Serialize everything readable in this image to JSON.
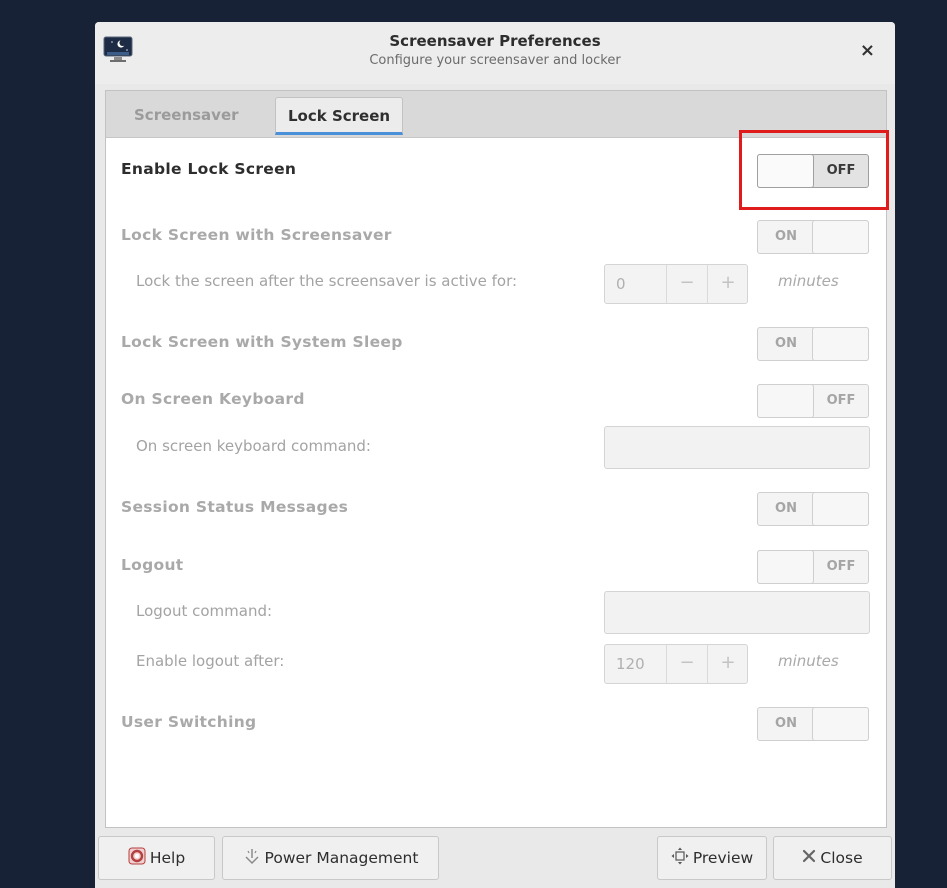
{
  "window": {
    "title": "Screensaver Preferences",
    "subtitle": "Configure your screensaver and locker",
    "close_glyph": "×"
  },
  "tabs": [
    {
      "label": "Screensaver",
      "selected": false
    },
    {
      "label": "Lock Screen",
      "selected": true
    }
  ],
  "settings": {
    "enable_lock_screen": {
      "label": "Enable Lock Screen",
      "state": "OFF"
    },
    "lock_with_screensaver": {
      "label": "Lock Screen with Screensaver",
      "state": "ON"
    },
    "lock_after": {
      "label": "Lock the screen after the screensaver is active for:",
      "value": "0",
      "unit": "minutes"
    },
    "lock_with_sleep": {
      "label": "Lock Screen with System Sleep",
      "state": "ON"
    },
    "on_screen_keyboard": {
      "label": "On Screen Keyboard",
      "state": "OFF"
    },
    "osk_command": {
      "label": "On screen keyboard command:",
      "value": ""
    },
    "session_status": {
      "label": "Session Status Messages",
      "state": "ON"
    },
    "logout": {
      "label": "Logout",
      "state": "OFF"
    },
    "logout_command": {
      "label": "Logout command:",
      "value": ""
    },
    "logout_after": {
      "label": "Enable logout after:",
      "value": "120",
      "unit": "minutes"
    },
    "user_switching": {
      "label": "User Switching",
      "state": "ON"
    }
  },
  "spin_glyphs": {
    "minus": "−",
    "plus": "+"
  },
  "buttons": {
    "help": "Help",
    "power_management": "Power Management",
    "preview": "Preview",
    "close": "Close"
  },
  "icons": {
    "app": "screensaver-monitor-icon",
    "help": "help-lifebuoy-icon",
    "power": "power-management-icon",
    "preview": "fullscreen-preview-icon",
    "close": "close-x-icon"
  },
  "colors": {
    "desktop": "#172236",
    "highlight": "#e01b1b",
    "tab_underline": "#4a90d9"
  }
}
